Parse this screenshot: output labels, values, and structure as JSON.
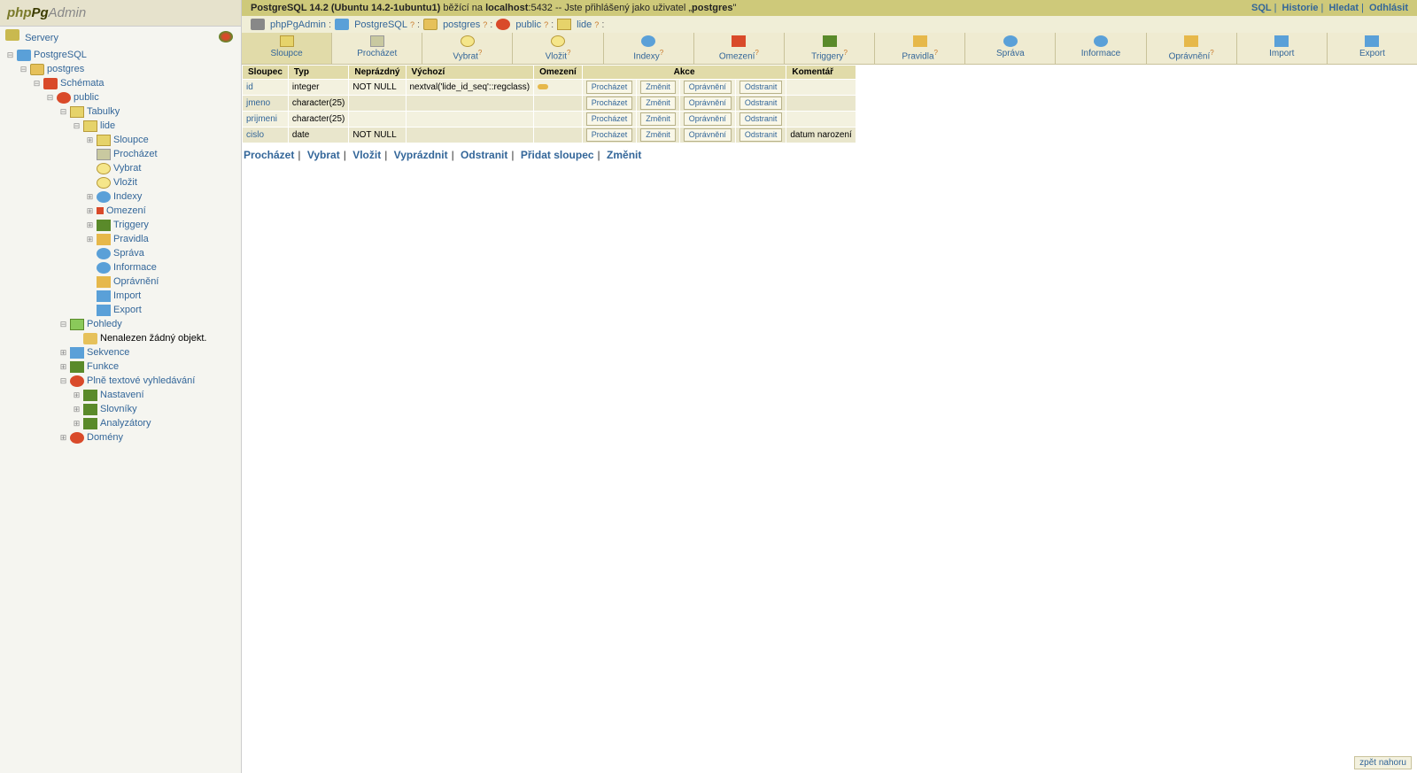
{
  "logo": {
    "php": "php",
    "pg": "Pg",
    "admin": "Admin"
  },
  "sidebar": {
    "servers": "Servery",
    "server": "PostgreSQL",
    "database": "postgres",
    "schemas": "Schémata",
    "schema": "public",
    "tables": "Tabulky",
    "table": "lide",
    "columns": "Sloupce",
    "browse": "Procházet",
    "select": "Vybrat",
    "insert": "Vložit",
    "indexes": "Indexy",
    "constraints": "Omezení",
    "triggers": "Triggery",
    "rules": "Pravidla",
    "admin": "Správa",
    "info": "Informace",
    "privileges": "Oprávnění",
    "import": "Import",
    "export": "Export",
    "views": "Pohledy",
    "views_empty": "Nenalezen žádný objekt.",
    "sequences": "Sekvence",
    "functions": "Funkce",
    "fts": "Plně textové vyhledávání",
    "fts_conf": "Nastavení",
    "fts_dict": "Slovníky",
    "fts_parser": "Analyzátory",
    "domains": "Domény"
  },
  "topbar": {
    "pre": "PostgreSQL 14.2 (Ubuntu 14.2-1ubuntu1)",
    "mid1": " běžící na ",
    "host": "localhost",
    "port": ":5432 -- Jste přihlášený jako uživatel „",
    "user": "postgres",
    "post": "\""
  },
  "toplinks": {
    "sql": "SQL",
    "history": "Historie",
    "find": "Hledat",
    "logout": "Odhlásit"
  },
  "crumbs": {
    "app": "phpPgAdmin",
    "server": "PostgreSQL",
    "database": "postgres",
    "schema": "public",
    "table": "lide"
  },
  "tabs": [
    {
      "id": "columns",
      "label": "Sloupce",
      "icon": "ico-columns",
      "sup": ""
    },
    {
      "id": "browse",
      "label": "Procházet",
      "icon": "ico-browse",
      "sup": ""
    },
    {
      "id": "select",
      "label": "Vybrat",
      "icon": "ico-select",
      "sup": "?"
    },
    {
      "id": "insert",
      "label": "Vložit",
      "icon": "ico-insert",
      "sup": "?"
    },
    {
      "id": "indexes",
      "label": "Indexy",
      "icon": "ico-indexes",
      "sup": "?"
    },
    {
      "id": "constraints",
      "label": "Omezení",
      "icon": "ico-constraints",
      "sup": "?"
    },
    {
      "id": "triggers",
      "label": "Triggery",
      "icon": "ico-triggers",
      "sup": "?"
    },
    {
      "id": "rules",
      "label": "Pravidla",
      "icon": "ico-rules",
      "sup": "?"
    },
    {
      "id": "admin",
      "label": "Správa",
      "icon": "ico-admin",
      "sup": ""
    },
    {
      "id": "info",
      "label": "Informace",
      "icon": "ico-info",
      "sup": ""
    },
    {
      "id": "privileges",
      "label": "Oprávnění",
      "icon": "ico-privs",
      "sup": "?"
    },
    {
      "id": "import",
      "label": "Import",
      "icon": "ico-import",
      "sup": ""
    },
    {
      "id": "export",
      "label": "Export",
      "icon": "ico-export",
      "sup": ""
    }
  ],
  "table": {
    "headers": {
      "column": "Sloupec",
      "type": "Typ",
      "notnull": "Neprázdný",
      "default": "Výchozí",
      "constraints": "Omezení",
      "actions": "Akce",
      "comment": "Komentář"
    },
    "action_labels": {
      "browse": "Procházet",
      "alter": "Změnit",
      "privileges": "Oprávnění",
      "drop": "Odstranit"
    },
    "rows": [
      {
        "name": "id",
        "type": "integer",
        "notnull": "NOT NULL",
        "default": "nextval('lide_id_seq'::regclass)",
        "has_key": true,
        "comment": ""
      },
      {
        "name": "jmeno",
        "type": "character(25)",
        "notnull": "",
        "default": "",
        "has_key": false,
        "comment": ""
      },
      {
        "name": "prijmeni",
        "type": "character(25)",
        "notnull": "",
        "default": "",
        "has_key": false,
        "comment": ""
      },
      {
        "name": "cislo",
        "type": "date",
        "notnull": "NOT NULL",
        "default": "",
        "has_key": false,
        "comment": "datum narození"
      }
    ]
  },
  "bottom_actions": {
    "browse": "Procházet",
    "select": "Vybrat",
    "insert": "Vložit",
    "empty": "Vyprázdnit",
    "drop": "Odstranit",
    "addcol": "Přidat sloupec",
    "alter": "Změnit"
  },
  "back_top": "zpět nahoru",
  "expand_dropdown": ":"
}
